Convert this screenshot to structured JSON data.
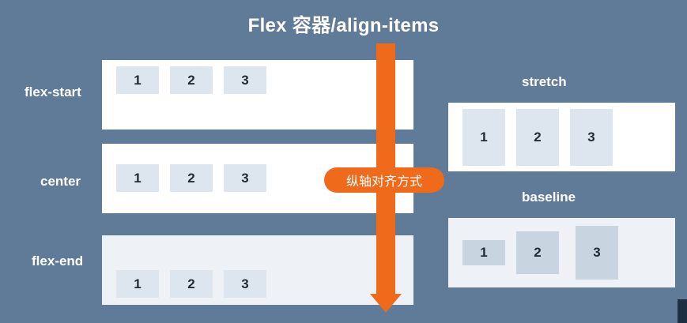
{
  "title": "Flex 容器/align-items",
  "axis_label": "纵轴对齐方式",
  "rows": [
    {
      "label": "flex-start",
      "items": [
        "1",
        "2",
        "3"
      ]
    },
    {
      "label": "center",
      "items": [
        "1",
        "2",
        "3"
      ]
    },
    {
      "label": "flex-end",
      "items": [
        "1",
        "2",
        "3"
      ]
    },
    {
      "label": "stretch",
      "items": [
        "1",
        "2",
        "3"
      ]
    },
    {
      "label": "baseline",
      "items": [
        "1",
        "2",
        "3"
      ]
    }
  ],
  "colors": {
    "background": "#5f7b97",
    "arrow": "#ef6a1b",
    "item": "#dde6ee"
  }
}
